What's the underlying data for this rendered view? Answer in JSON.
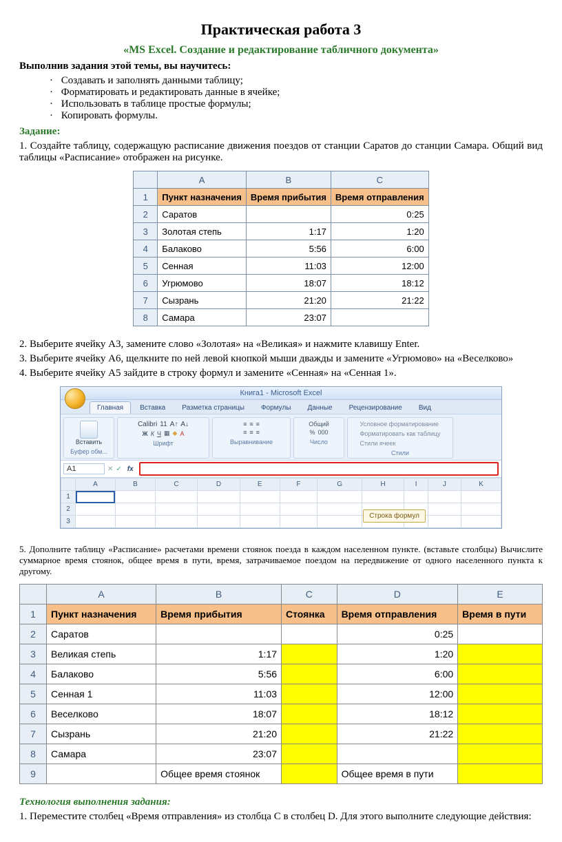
{
  "title": "Практическая работа 3",
  "subtitle": "«MS Excel. Создание и редактирование табличного документа»",
  "learn_head": "Выполнив задания этой темы, вы научитесь:",
  "bullets": [
    "Создавать и заполнять данными таблицу;",
    "Форматировать и редактировать данные в ячейке;",
    "Использовать в таблице простые формулы;",
    "Копировать формулы."
  ],
  "task_head": "Задание:",
  "task1": "1. Создайте таблицу, содержащую расписание движения поездов от станции Саратов до станции Самара. Общий вид таблицы «Расписание» отображен на рисунке.",
  "sheet1": {
    "cols": [
      "A",
      "B",
      "C"
    ],
    "header": [
      "Пункт назначения",
      "Время прибытия",
      "Время отправления"
    ],
    "rows": [
      {
        "n": "2",
        "a": "Саратов",
        "b": "",
        "c": "0:25"
      },
      {
        "n": "3",
        "a": "Золотая степь",
        "b": "1:17",
        "c": "1:20"
      },
      {
        "n": "4",
        "a": "Балаково",
        "b": "5:56",
        "c": "6:00"
      },
      {
        "n": "5",
        "a": "Сенная",
        "b": "11:03",
        "c": "12:00"
      },
      {
        "n": "6",
        "a": "Угрюмово",
        "b": "18:07",
        "c": "18:12"
      },
      {
        "n": "7",
        "a": "Сызрань",
        "b": "21:20",
        "c": "21:22"
      },
      {
        "n": "8",
        "a": "Самара",
        "b": "23:07",
        "c": ""
      }
    ]
  },
  "step2": "2.   Выберите ячейку А3, замените слово «Золотая» на «Великая» и нажмите клавишу Enter.",
  "step3": "3.   Выберите ячейку А6, щелкните по ней левой кнопкой мыши дважды и замените «Угрюмово» на «Веселково»",
  "step4": "4.   Выберите ячейку А5 зайдите в строку формул и замените «Сенная» на «Сенная 1».",
  "ribbon": {
    "title": "Книга1 - Microsoft Excel",
    "tabs": [
      "Главная",
      "Вставка",
      "Разметка страницы",
      "Формулы",
      "Данные",
      "Рецензирование",
      "Вид"
    ],
    "paste": "Вставить",
    "clip_label": "Буфер обм...",
    "font_name": "Calibri",
    "font_size": "11",
    "font_label": "Шрифт",
    "align_label": "Выравнивание",
    "num_label": "Число",
    "num_mode": "Общий",
    "styles_label": "Стили",
    "style1": "Условное форматирование",
    "style2": "Форматировать как таблицу",
    "style3": "Стили ячеек",
    "namebox": "A1",
    "fx": "fx",
    "cols": [
      "A",
      "B",
      "C",
      "D",
      "E",
      "F",
      "G",
      "H",
      "I",
      "J",
      "K"
    ],
    "rownums": [
      "1",
      "2",
      "3"
    ],
    "callout": "Строка формул"
  },
  "step5": "5.   Дополните таблицу «Расписание» расчетами времени стоянок поезда в каждом населенном пункте. (вставьте столбцы) Вычислите суммарное время стоянок, общее время в пути, время, затрачиваемое поездом на передвижение от одного населенного пункта к другому.",
  "sheet2": {
    "cols": [
      "A",
      "B",
      "C",
      "D",
      "E"
    ],
    "header": [
      "Пункт назначения",
      "Время прибытия",
      "Стоянка",
      "Время отправления",
      "Время в пути"
    ],
    "rows": [
      {
        "n": "2",
        "a": "Саратов",
        "b": "",
        "c": "",
        "d": "0:25",
        "e": "",
        "cy": false,
        "ey": false
      },
      {
        "n": "3",
        "a": "Великая степь",
        "b": "1:17",
        "c": "",
        "d": "1:20",
        "e": "",
        "cy": true,
        "ey": true
      },
      {
        "n": "4",
        "a": "Балаково",
        "b": "5:56",
        "c": "",
        "d": "6:00",
        "e": "",
        "cy": true,
        "ey": true
      },
      {
        "n": "5",
        "a": "Сенная 1",
        "b": "11:03",
        "c": "",
        "d": "12:00",
        "e": "",
        "cy": true,
        "ey": true
      },
      {
        "n": "6",
        "a": "Веселково",
        "b": "18:07",
        "c": "",
        "d": "18:12",
        "e": "",
        "cy": true,
        "ey": true
      },
      {
        "n": "7",
        "a": "Сызрань",
        "b": "21:20",
        "c": "",
        "d": "21:22",
        "e": "",
        "cy": true,
        "ey": true
      },
      {
        "n": "8",
        "a": "Самара",
        "b": "23:07",
        "c": "",
        "d": "",
        "e": "",
        "cy": true,
        "ey": true
      }
    ],
    "footer": {
      "n": "9",
      "b": "Общее время стоянок",
      "d": "Общее время в пути"
    }
  },
  "tech_head": "Технология выполнения задания:",
  "tech1": "1.   Переместите столбец «Время отправления» из столбца С в столбец D. Для этого выполните следующие действия:"
}
